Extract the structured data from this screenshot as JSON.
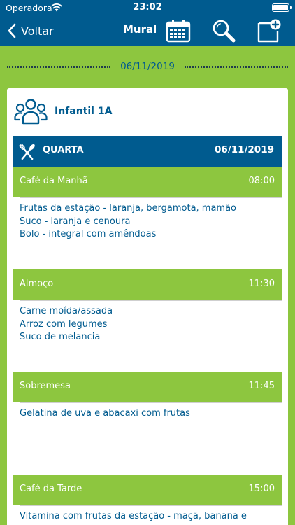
{
  "status": {
    "carrier": "Operadora",
    "time": "23:02"
  },
  "nav": {
    "back_label": "Voltar",
    "title": "Mural"
  },
  "date_divider": "06/11/2019",
  "class_name": "Infantil 1A",
  "day": {
    "name": "QUARTA",
    "date": "06/11/2019"
  },
  "meals": [
    {
      "name": "Café da Manhã",
      "time": "08:00",
      "items": [
        "Frutas da estação - laranja, bergamota, mamão",
        "Suco - laranja e cenoura",
        "Bolo - integral com amêndoas"
      ]
    },
    {
      "name": "Almoço",
      "time": "11:30",
      "items": [
        "Carne moída/assada",
        "Arroz com legumes",
        "Suco de melancia"
      ]
    },
    {
      "name": "Sobremesa",
      "time": "11:45",
      "items": [
        "Gelatina de uva e abacaxi com frutas"
      ]
    },
    {
      "name": "Café da Tarde",
      "time": "15:00",
      "items": [
        "Vitamina com frutas da estação - maçã, banana e"
      ]
    }
  ],
  "colors": {
    "primary": "#005b8f",
    "accent": "#8dc63f",
    "card": "#ffffff"
  }
}
